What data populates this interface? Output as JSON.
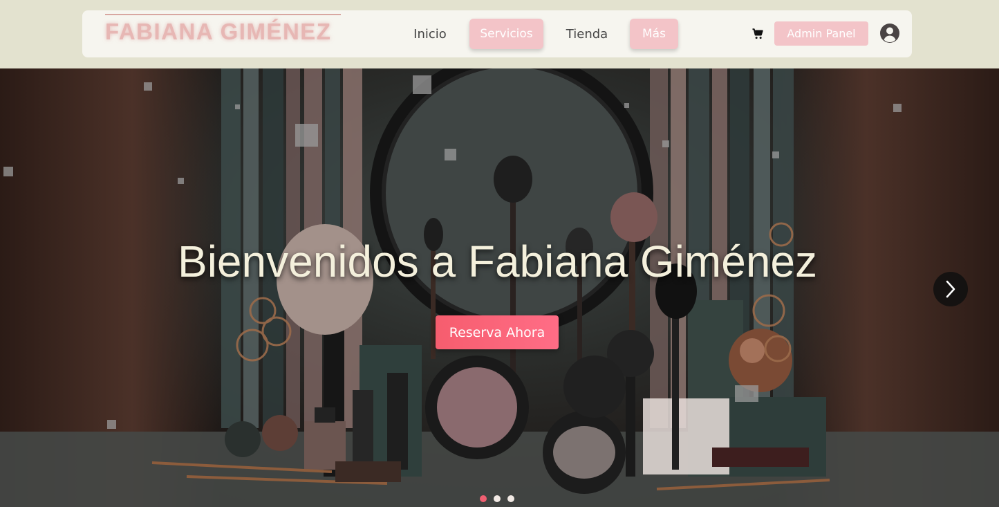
{
  "brand": {
    "logo_text": "FABIANA GIMÉNEZ"
  },
  "nav": {
    "links": [
      {
        "label": "Inicio",
        "highlight": false
      },
      {
        "label": "Servicios",
        "highlight": true
      },
      {
        "label": "Tienda",
        "highlight": false
      },
      {
        "label": "Más",
        "highlight": true
      }
    ],
    "admin_label": "Admin Panel",
    "icons": {
      "cart": "cart-icon",
      "user": "user-circle-icon"
    }
  },
  "hero": {
    "title": "Bienvenidos a Fabiana Giménez",
    "cta_label": "Reserva Ahora",
    "next_icon": "chevron-right-icon",
    "slides": 3,
    "active_slide": 1
  },
  "colors": {
    "topbar_bg": "#e3e2cf",
    "navbar_bg": "#f6f5ef",
    "pill_bg": "#f3c4c8",
    "cta_bg": "#f65d6e",
    "dot_active": "#f05f71"
  }
}
